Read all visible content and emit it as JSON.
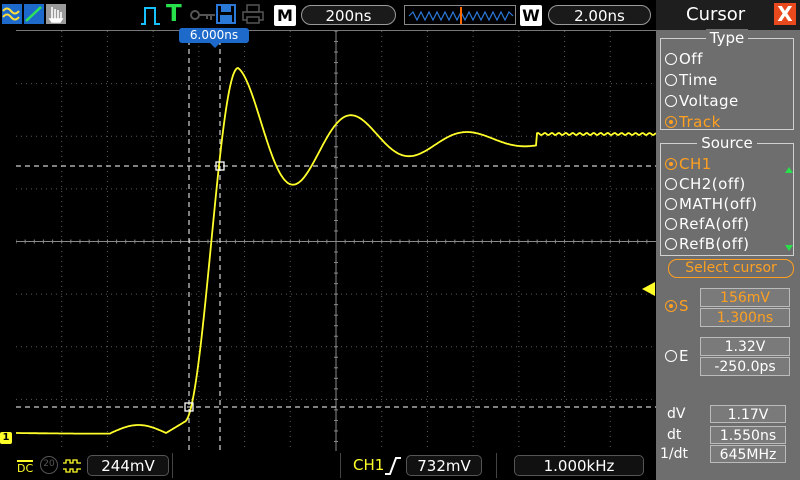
{
  "colors": {
    "trace": "#ffff2a",
    "accent": "#ffa020",
    "cyan": "#19c0ff",
    "green": "#27e04a",
    "close": "#e8491d",
    "panel": "#6e6e6e"
  },
  "top_bar": {
    "time_base_label": "M",
    "time_base": "200ns",
    "window_label": "W",
    "window_value": "2.00ns",
    "trigger_status": "T"
  },
  "scope": {
    "cursor_readout": "6.000ns",
    "channel_marker": "1"
  },
  "bottom_bar": {
    "coupling": "DC",
    "bandwidth_limit": "20",
    "ch1_scale": "244mV",
    "trigger_source": "CH1",
    "trigger_level": "732mV",
    "frequency": "1.000kHz"
  },
  "panel": {
    "title": "Cursor",
    "close_glyph": "X",
    "type_group": {
      "title": "Type",
      "options": [
        "Off",
        "Time",
        "Voltage",
        "Track"
      ],
      "selected": 3
    },
    "source_group": {
      "title": "Source",
      "options": [
        "CH1",
        "CH2(off)",
        "MATH(off)",
        "RefA(off)",
        "RefB(off)"
      ],
      "selected": 0
    },
    "select_cursor_label": "Select cursor",
    "s_label": "S",
    "s_voltage": "156mV",
    "s_time": "1.300ns",
    "e_label": "E",
    "e_voltage": "1.32V",
    "e_time": "-250.0ps",
    "dv_label": "dV",
    "dv_value": "1.17V",
    "dt_label": "dt",
    "dt_value": "1.550ns",
    "inv_dt_label": "1/dt",
    "inv_dt_value": "645MHz"
  }
}
